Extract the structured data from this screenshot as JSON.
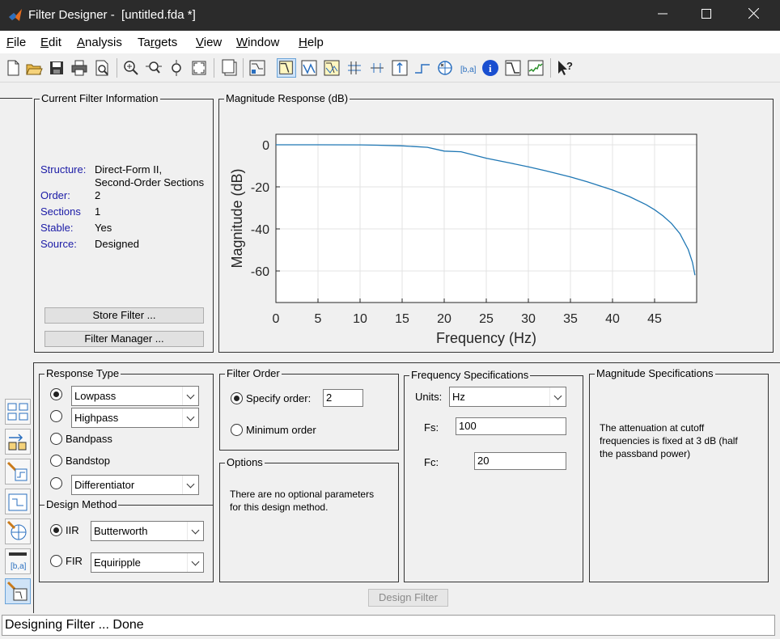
{
  "window": {
    "title": "Filter Designer -  [untitled.fda *]"
  },
  "menu": [
    "File",
    "Edit",
    "Analysis",
    "Targets",
    "View",
    "Window",
    "Help"
  ],
  "menu_mnemonic": [
    "F",
    "E",
    "A",
    "r",
    "V",
    "W",
    "H"
  ],
  "toolbar_icons": [
    "new-icon",
    "open-icon",
    "save-icon",
    "print-icon",
    "print-preview-icon",
    "zoom-in-icon",
    "zoom-x-icon",
    "zoom-y-icon",
    "full-view-icon",
    "new-figure-icon",
    "filter-spec-icon",
    "magnitude-response-icon",
    "phase-response-icon",
    "magnitude-phase-icon",
    "group-delay-icon",
    "phase-delay-icon",
    "impulse-response-icon",
    "step-response-icon",
    "pole-zero-icon",
    "coefficients-icon",
    "filter-info-icon",
    "magnitude-estimate-icon",
    "round-off-noise-icon",
    "whats-this-icon"
  ],
  "current_filter": {
    "legend": "Current Filter Information",
    "rows": [
      {
        "label": "Structure:",
        "value": "Direct-Form II,"
      },
      {
        "label": "",
        "value": "Second-Order Sections"
      },
      {
        "label": "Order:",
        "value": "2"
      },
      {
        "label": "Sections",
        "value": "1"
      },
      {
        "label": "Stable:",
        "value": "Yes"
      },
      {
        "label": "Source:",
        "value": "Designed"
      }
    ],
    "store_button": "Store Filter ...",
    "manager_button": "Filter Manager ..."
  },
  "plot": {
    "legend": "Magnitude Response (dB)",
    "chart_data": {
      "type": "line",
      "xlabel": "Frequency (Hz)",
      "ylabel": "Magnitude (dB)",
      "xlim": [
        0,
        50
      ],
      "ylim": [
        -75,
        5
      ],
      "xticks": [
        "0",
        "5",
        "10",
        "15",
        "20",
        "25",
        "30",
        "35",
        "40",
        "45"
      ],
      "yticks": [
        "0",
        "-20",
        "-40",
        "-60"
      ],
      "grid": true,
      "series": [
        {
          "color": "#1f77b4",
          "x": [
            0,
            5,
            10,
            12,
            15,
            18,
            20,
            22,
            25,
            28,
            30,
            32,
            35,
            37,
            40,
            42,
            44,
            45,
            46,
            47,
            48,
            49,
            49.5,
            49.8
          ],
          "y": [
            0,
            -0.0,
            -0.02,
            -0.2,
            -0.5,
            -1.2,
            -3.0,
            -3.3,
            -6.4,
            -8.8,
            -10.5,
            -12.3,
            -15.3,
            -17.6,
            -21.5,
            -24.6,
            -28.5,
            -30.9,
            -33.8,
            -37.4,
            -42.2,
            -49.8,
            -55.9,
            -62.0
          ]
        }
      ]
    }
  },
  "response_type": {
    "legend": "Response Type",
    "lowpass": "Lowpass",
    "highpass": "Highpass",
    "bandpass": "Bandpass",
    "bandstop": "Bandstop",
    "differentiator": "Differentiator"
  },
  "design_method": {
    "legend": "Design Method",
    "iir_label": "IIR",
    "iir_value": "Butterworth",
    "fir_label": "FIR",
    "fir_value": "Equiripple"
  },
  "filter_order": {
    "legend": "Filter Order",
    "specify_label": "Specify order:",
    "specify_value": "2",
    "minimum_label": "Minimum order"
  },
  "options": {
    "legend": "Options",
    "text1": "There are no optional parameters",
    "text2": "for this design method."
  },
  "freq_specs": {
    "legend": "Frequency Specifications",
    "units_label": "Units:",
    "units_value": "Hz",
    "fs_label": "Fs:",
    "fs_value": "100",
    "fc_label": "Fc:",
    "fc_value": "20"
  },
  "mag_specs": {
    "legend": "Magnitude Specifications",
    "text1": "The attenuation at cutoff",
    "text2": "frequencies is fixed at 3 dB (half",
    "text3": "the passband power)"
  },
  "design_button": "Design Filter",
  "status": "Designing Filter ... Done",
  "sidebar_icons": [
    "transform-filter-icon",
    "convert-structure-icon",
    "import-filter-icon",
    "pole-zero-editor-icon",
    "realize-model-icon",
    "multirate-icon",
    "design-filter-icon"
  ]
}
